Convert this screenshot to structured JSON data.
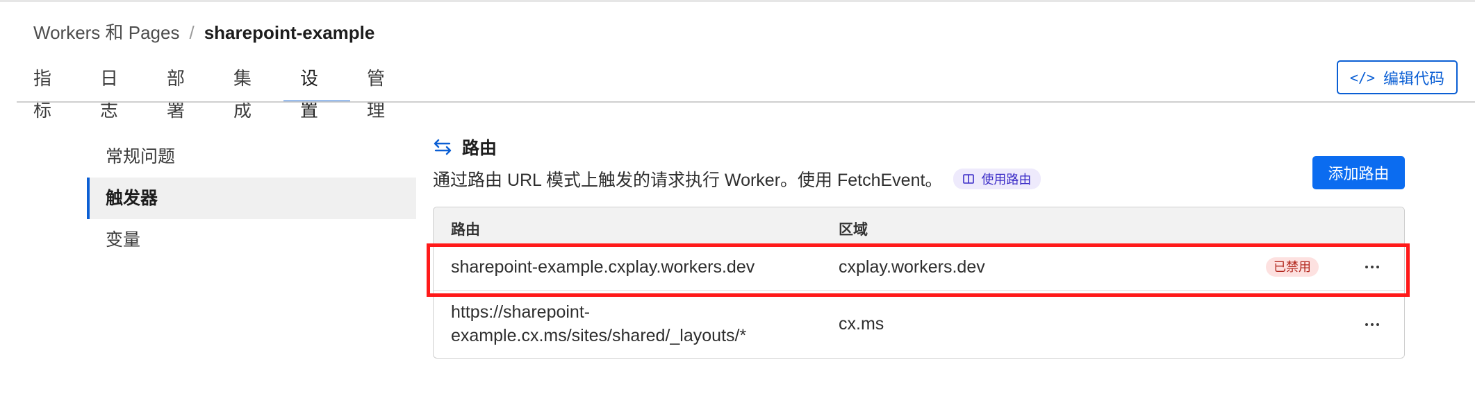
{
  "breadcrumb": {
    "root": "Workers 和 Pages",
    "separator": "/",
    "current": "sharepoint-example"
  },
  "tabs": [
    {
      "label": "指标",
      "active": false
    },
    {
      "label": "日志",
      "active": false
    },
    {
      "label": "部署",
      "active": false
    },
    {
      "label": "集成",
      "active": false
    },
    {
      "label": "设置",
      "active": true
    },
    {
      "label": "管理",
      "active": false
    }
  ],
  "toolbar": {
    "edit_code_label": "编辑代码",
    "edit_code_icon": "code-icon"
  },
  "sidebar": {
    "items": [
      {
        "label": "常规问题",
        "active": false
      },
      {
        "label": "触发器",
        "active": true
      },
      {
        "label": "变量",
        "active": false
      }
    ]
  },
  "routes": {
    "title": "路由",
    "title_icon": "routes-icon",
    "description": "通过路由 URL 模式上触发的请求执行 Worker。使用 FetchEvent。",
    "doc_link_label": "使用路由",
    "add_button_label": "添加路由",
    "table": {
      "columns": [
        "路由",
        "区域"
      ],
      "rows": [
        {
          "route": "sharepoint-example.cxplay.workers.dev",
          "zone": "cxplay.workers.dev",
          "status": "已禁用"
        },
        {
          "route_line1": "https://sharepoint-",
          "route_line2": "example.cx.ms/sites/shared/_layouts/*",
          "zone": "cx.ms",
          "status": ""
        }
      ]
    }
  },
  "colors": {
    "accent": "#0b5fd4",
    "primary_button": "#0b6cf0",
    "disabled_badge_bg": "#fde1e0",
    "disabled_badge_text": "#b2261c",
    "highlight": "#ff1a1a"
  }
}
